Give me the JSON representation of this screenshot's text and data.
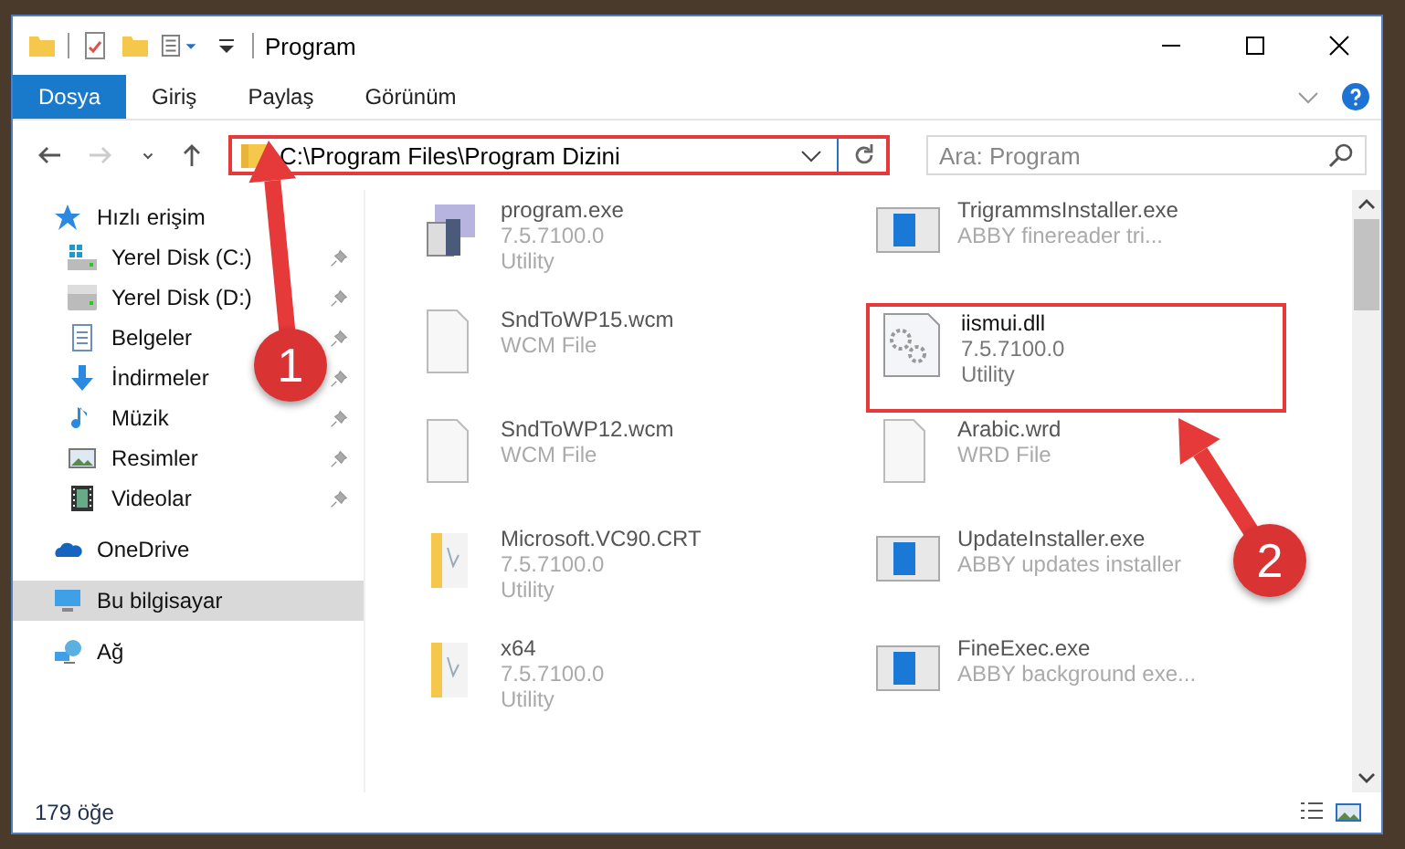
{
  "window": {
    "title": "Program"
  },
  "ribbon_tabs": [
    {
      "label": "Dosya",
      "selected": true
    },
    {
      "label": "Giriş",
      "selected": false
    },
    {
      "label": "Paylaş",
      "selected": false
    },
    {
      "label": "Görünüm",
      "selected": false
    }
  ],
  "address": {
    "value": "C:\\Program Files\\Program Dizini",
    "highlighted": true
  },
  "search": {
    "placeholder": "Ara: Program"
  },
  "sidebar": {
    "items": [
      {
        "label": "Hızlı erişim",
        "kind": "star",
        "pinned": false,
        "selected": false,
        "children": [
          {
            "label": "Yerel Disk (C:)",
            "kind": "drive-c",
            "pinned": true,
            "selected": false
          },
          {
            "label": "Yerel Disk (D:)",
            "kind": "drive",
            "pinned": true,
            "selected": false
          },
          {
            "label": "Belgeler",
            "kind": "docs",
            "pinned": true,
            "selected": false
          },
          {
            "label": "İndirmeler",
            "kind": "download",
            "pinned": true,
            "selected": false
          },
          {
            "label": "Müzik",
            "kind": "music",
            "pinned": true,
            "selected": false
          },
          {
            "label": "Resimler",
            "kind": "pictures",
            "pinned": true,
            "selected": false
          },
          {
            "label": "Videolar",
            "kind": "videos",
            "pinned": true,
            "selected": false
          }
        ]
      },
      {
        "label": "OneDrive",
        "kind": "cloud",
        "pinned": false,
        "selected": false
      },
      {
        "label": "Bu bilgisayar",
        "kind": "pc",
        "pinned": false,
        "selected": true
      },
      {
        "label": "Ağ",
        "kind": "network",
        "pinned": false,
        "selected": false
      }
    ]
  },
  "files": [
    {
      "name": "program.exe",
      "lines": [
        "7.5.7100.0",
        "Utility"
      ],
      "kind": "app",
      "highlighted": false
    },
    {
      "name": "TrigrammsInstaller.exe",
      "lines": [
        "ABBY finereader tri..."
      ],
      "kind": "installer",
      "highlighted": false
    },
    {
      "name": "SndToWP15.wcm",
      "lines": [
        "WCM File"
      ],
      "kind": "file",
      "highlighted": false
    },
    {
      "name": "iismui.dll",
      "lines": [
        "7.5.7100.0",
        "Utility"
      ],
      "kind": "dll",
      "highlighted": true
    },
    {
      "name": "SndToWP12.wcm",
      "lines": [
        "WCM File"
      ],
      "kind": "file",
      "highlighted": false
    },
    {
      "name": "Arabic.wrd",
      "lines": [
        "WRD File"
      ],
      "kind": "file",
      "highlighted": false
    },
    {
      "name": "Microsoft.VC90.CRT",
      "lines": [
        "7.5.7100.0",
        "Utility"
      ],
      "kind": "folder",
      "highlighted": false
    },
    {
      "name": "UpdateInstaller.exe",
      "lines": [
        "ABBY updates installer"
      ],
      "kind": "installer",
      "highlighted": false
    },
    {
      "name": "x64",
      "lines": [
        "7.5.7100.0",
        "Utility"
      ],
      "kind": "folder",
      "highlighted": false
    },
    {
      "name": "FineExec.exe",
      "lines": [
        "ABBY background exe..."
      ],
      "kind": "installer",
      "highlighted": false
    }
  ],
  "status_bar": {
    "count": "179 öğe"
  },
  "annotations": [
    {
      "number": "1"
    },
    {
      "number": "2"
    }
  ]
}
